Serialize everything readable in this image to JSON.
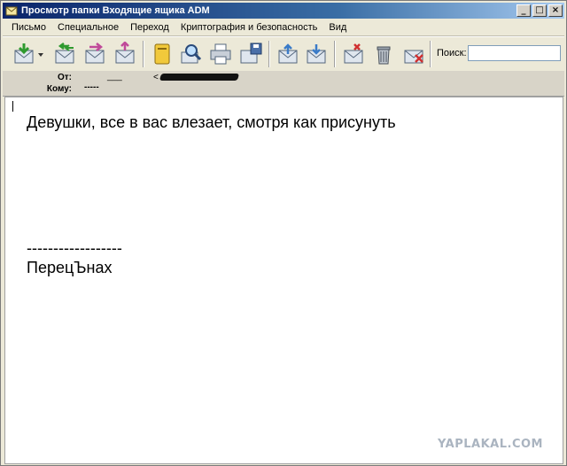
{
  "window": {
    "title": "Просмотр папки Входящие ящика ADM",
    "minimize": "_",
    "maximize": "□",
    "close": "×"
  },
  "menu": {
    "items": [
      {
        "label": "Письмо"
      },
      {
        "label": "Специальное"
      },
      {
        "label": "Переход"
      },
      {
        "label": "Криптография и безопасность"
      },
      {
        "label": "Вид"
      }
    ]
  },
  "toolbar": {
    "icons": [
      "get-mail-icon",
      "dropdown-arrow-icon",
      "reply-all-icon",
      "forward-icon",
      "send-icon",
      "address-book-icon",
      "find-icon",
      "print-icon",
      "save-icon",
      "move-up-icon",
      "move-down-icon",
      "mark-icon",
      "trash-icon",
      "delete-icon"
    ],
    "search_label": "Поиск:",
    "search_value": ""
  },
  "header": {
    "from_label": "От:",
    "from_value_a": "___",
    "from_value_b": "<",
    "to_label": "Кому:",
    "to_value": "-----"
  },
  "message": {
    "line1": "Девушки, все в вас влезает, смотря как присунуть",
    "separator": "------------------",
    "signature": "ПерецЪнах"
  },
  "watermark": "YAPLAKAL.COM",
  "colors": {
    "titlebar_start": "#0a246a",
    "titlebar_end": "#a6caf0",
    "chrome": "#ece9d8",
    "body": "#ffffff"
  }
}
